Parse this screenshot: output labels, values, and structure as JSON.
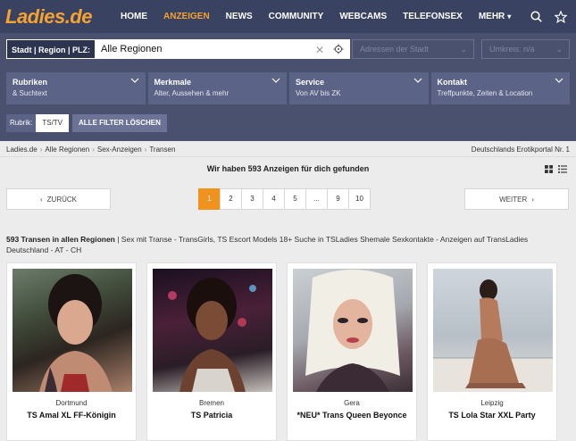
{
  "header": {
    "logo": "Ladies.de",
    "nav": [
      {
        "label": "HOME",
        "active": false
      },
      {
        "label": "ANZEIGEN",
        "active": true
      },
      {
        "label": "NEWS",
        "active": false
      },
      {
        "label": "COMMUNITY",
        "active": false
      },
      {
        "label": "WEBCAMS",
        "active": false
      },
      {
        "label": "TELEFONSEX",
        "active": false
      },
      {
        "label": "MEHR",
        "active": false
      }
    ],
    "accent_color": "#f4a232"
  },
  "search": {
    "location_label": "Stadt | Region | PLZ:",
    "location_value": "Alle Regionen",
    "city_select": "Adressen der Stadt",
    "radius_select": "Umkreis: n/a"
  },
  "filters": [
    {
      "title": "Rubriken",
      "subtitle": "& Suchtext"
    },
    {
      "title": "Merkmale",
      "subtitle": "Alter, Aussehen & mehr"
    },
    {
      "title": "Service",
      "subtitle": "Von AV bis ZK"
    },
    {
      "title": "Kontakt",
      "subtitle": "Treffpunkte, Zeiten & Location"
    }
  ],
  "active_filter": {
    "label": "Rubrik:",
    "value": "TS/TV",
    "clear_label": "ALLE FILTER LÖSCHEN"
  },
  "breadcrumb": {
    "items": [
      "Ladies.de",
      "Alle Regionen",
      "Sex-Anzeigen",
      "Transen"
    ],
    "right_text": "Deutschlands Erotikportal Nr. 1"
  },
  "results": {
    "title": "Wir haben 593 Anzeigen für dich gefunden",
    "desc_bold": "593 Transen in allen Regionen",
    "desc_rest": " | Sex mit Transe - TransGirls, TS Escort Models 18+ Suche in TSLadies Shemale Sexkontakte - Anzeigen auf TransLadies Deutschland - AT - CH"
  },
  "pagination": {
    "prev_label": "ZURÜCK",
    "next_label": "WEITER",
    "pages": [
      "1",
      "2",
      "3",
      "4",
      "5",
      "...",
      "9",
      "10"
    ],
    "current": "1"
  },
  "cards": [
    {
      "city": "Dortmund",
      "name": "TS Amal XL FF-Königin"
    },
    {
      "city": "Bremen",
      "name": "TS Patricia"
    },
    {
      "city": "Gera",
      "name": "*NEU* Trans Queen Beyonce"
    },
    {
      "city": "Leipzig",
      "name": "TS Lola Star XXL Party"
    }
  ]
}
